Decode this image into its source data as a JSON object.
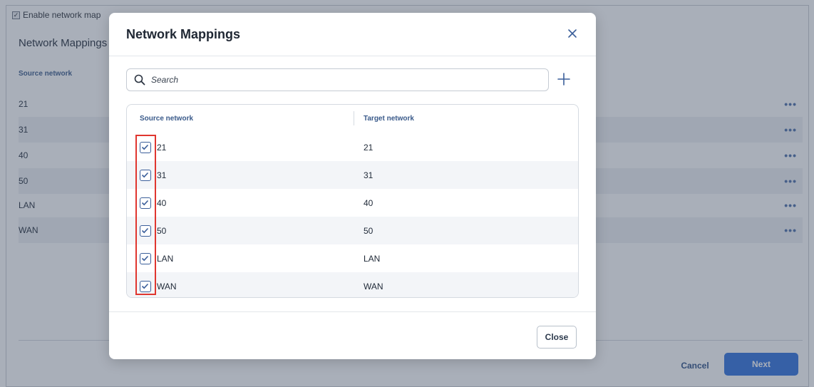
{
  "background": {
    "enable_checkbox_label": "Enable network map",
    "section_title": "Network Mappings",
    "column_header": "Source network",
    "rows": [
      "21",
      "31",
      "40",
      "50",
      "LAN",
      "WAN"
    ],
    "row_menu_label": "•••",
    "cancel_label": "Cancel",
    "next_label": "Next"
  },
  "modal": {
    "title": "Network Mappings",
    "search_placeholder": "Search",
    "columns": {
      "source": "Source network",
      "target": "Target network"
    },
    "rows": [
      {
        "source": "21",
        "target": "21",
        "checked": true
      },
      {
        "source": "31",
        "target": "31",
        "checked": true
      },
      {
        "source": "40",
        "target": "40",
        "checked": true
      },
      {
        "source": "50",
        "target": "50",
        "checked": true
      },
      {
        "source": "LAN",
        "target": "LAN",
        "checked": true
      },
      {
        "source": "WAN",
        "target": "WAN",
        "checked": true
      }
    ],
    "close_label": "Close"
  },
  "colors": {
    "accent": "#2f6fdc",
    "highlight": "#e0362f",
    "header_text": "#3a5a8a"
  }
}
